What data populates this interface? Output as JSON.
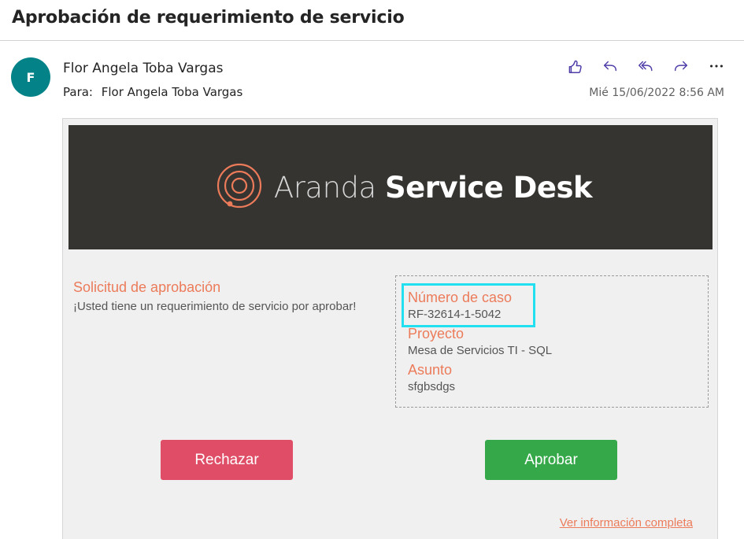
{
  "email": {
    "subject": "Aprobación de requerimiento de servicio",
    "avatar_initial": "F",
    "sender_name": "Flor Angela Toba Vargas",
    "to_label": "Para:",
    "to_name": "Flor Angela Toba Vargas",
    "date": "Mié 15/06/2022 8:56 AM",
    "actions": [
      "like-icon",
      "reply-icon",
      "reply-all-icon",
      "forward-icon",
      "more-icon"
    ]
  },
  "banner": {
    "brand_light": "Aranda ",
    "brand_bold": "Service Desk"
  },
  "request": {
    "title": "Solicitud de aprobación",
    "text": "¡Usted tiene un requerimiento de servicio por aprobar!"
  },
  "details": {
    "case_label": "Número de caso",
    "case_value": "RF-32614-1-5042",
    "project_label": "Proyecto",
    "project_value": "Mesa de Servicios TI - SQL",
    "subject_label": "Asunto",
    "subject_value": "sfgbsdgs"
  },
  "buttons": {
    "reject": "Rechazar",
    "approve": "Aprobar"
  },
  "link": {
    "more_info": "Ver información completa"
  },
  "colors": {
    "accent": "#ec7b5a",
    "reject": "#e04d67",
    "approve": "#35a94a",
    "banner": "#353431",
    "avatar": "#038387",
    "highlight": "#22e0ef",
    "icons": "#4f3ea8"
  }
}
